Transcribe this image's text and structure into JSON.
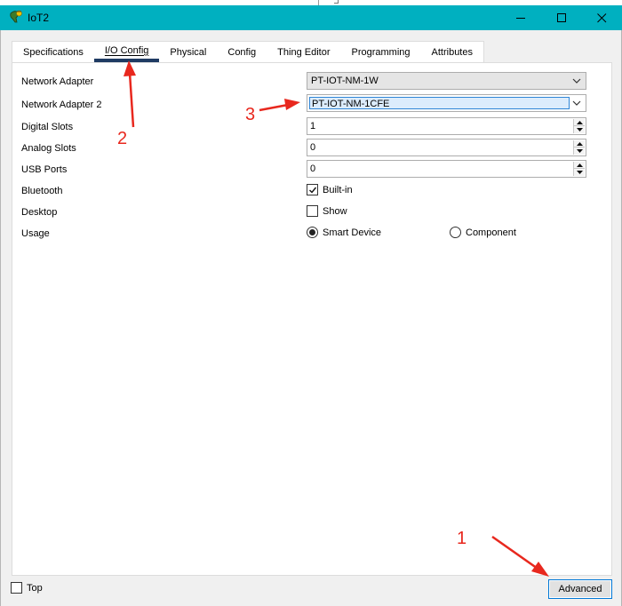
{
  "window": {
    "title": "IoT2",
    "icon": "iot-device-icon",
    "controls": [
      "minimize-icon",
      "maximize-icon",
      "close-icon"
    ]
  },
  "tabs": [
    {
      "label": "Specifications",
      "active": false
    },
    {
      "label": "I/O Config",
      "active": true
    },
    {
      "label": "Physical",
      "active": false
    },
    {
      "label": "Config",
      "active": false
    },
    {
      "label": "Thing Editor",
      "active": false
    },
    {
      "label": "Programming",
      "active": false
    },
    {
      "label": "Attributes",
      "active": false
    }
  ],
  "io_config": {
    "network_adapter": {
      "label": "Network Adapter",
      "value": "PT-IOT-NM-1W"
    },
    "network_adapter_2": {
      "label": "Network Adapter 2",
      "value": "PT-IOT-NM-1CFE"
    },
    "digital_slots": {
      "label": "Digital Slots",
      "value": "1"
    },
    "analog_slots": {
      "label": "Analog Slots",
      "value": "0"
    },
    "usb_ports": {
      "label": "USB Ports",
      "value": "0"
    },
    "bluetooth": {
      "label": "Bluetooth",
      "option": "Built-in",
      "checked": true
    },
    "desktop": {
      "label": "Desktop",
      "option": "Show",
      "checked": false
    },
    "usage": {
      "label": "Usage",
      "options": [
        {
          "label": "Smart Device",
          "selected": true
        },
        {
          "label": "Component",
          "selected": false
        }
      ]
    }
  },
  "footer": {
    "top_label": "Top",
    "top_checked": false,
    "advanced_label": "Advanced"
  },
  "annotations": {
    "color": "#e8281e",
    "marks": [
      "1",
      "2",
      "3"
    ]
  },
  "colors": {
    "titlebar": "#00b0c0",
    "active_tab_underline": "#1f3b63",
    "focus_border": "#0078d7"
  }
}
